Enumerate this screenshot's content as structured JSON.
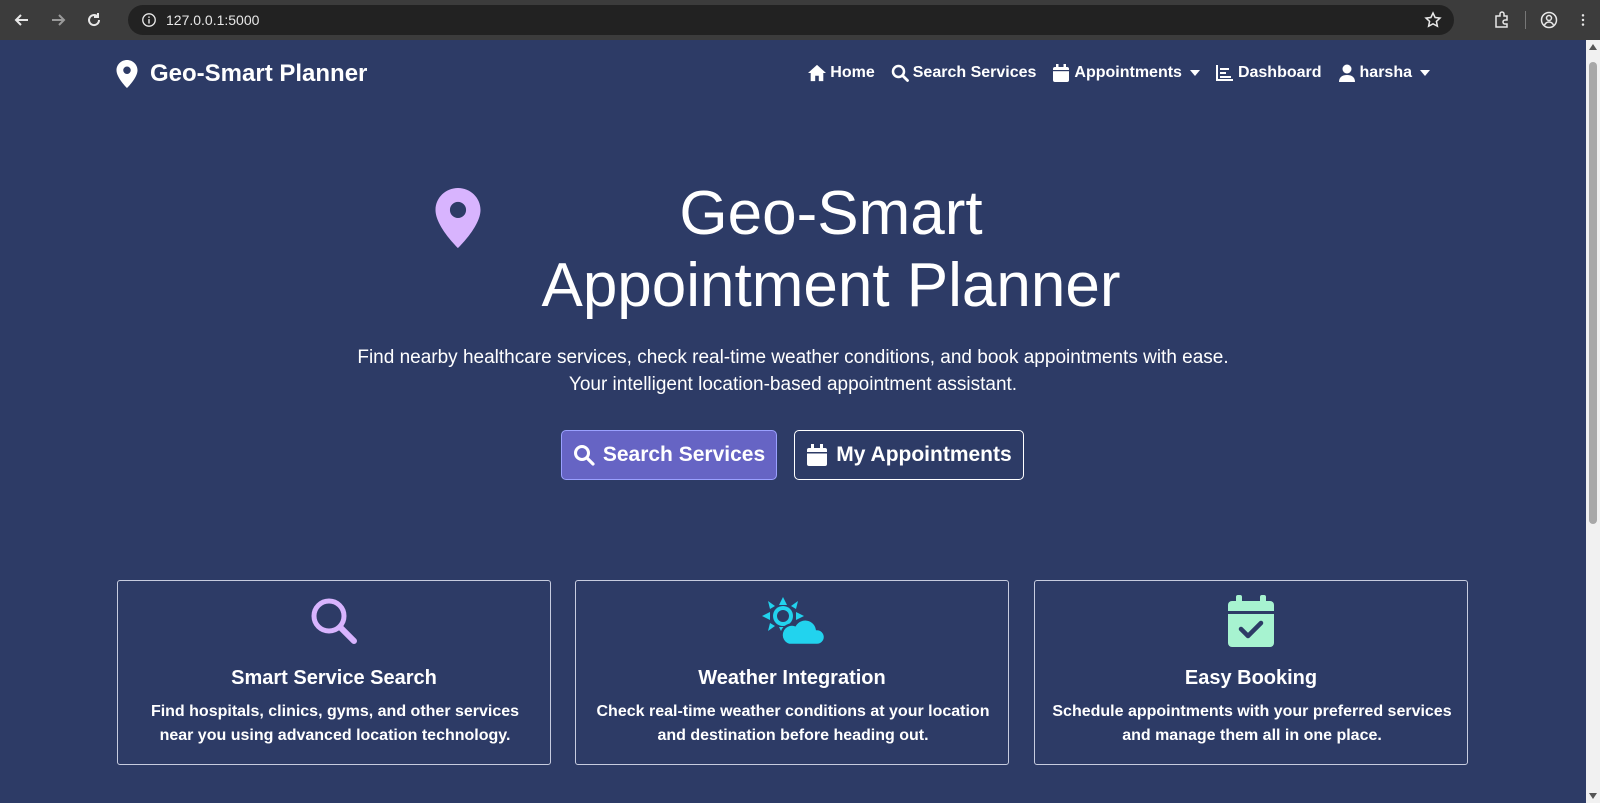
{
  "browser": {
    "url": "127.0.0.1:5000"
  },
  "navbar": {
    "brand": "Geo-Smart Planner",
    "links": [
      {
        "label": "Home",
        "icon": "home-icon"
      },
      {
        "label": "Search Services",
        "icon": "search-icon"
      },
      {
        "label": "Appointments",
        "icon": "calendar-icon",
        "dropdown": true
      },
      {
        "label": "Dashboard",
        "icon": "chart-icon"
      },
      {
        "label": "harsha",
        "icon": "user-icon",
        "dropdown": true
      }
    ]
  },
  "hero": {
    "title": "Geo-Smart Appointment Planner",
    "subtitle_line1": "Find nearby healthcare services, check real-time weather conditions, and book appointments with ease.",
    "subtitle_line2": "Your intelligent location-based appointment assistant.",
    "primary_button": "Search Services",
    "secondary_button": "My Appointments"
  },
  "features": [
    {
      "title": "Smart Service Search",
      "description": "Find hospitals, clinics, gyms, and other services near you using advanced location technology.",
      "icon": "search-icon",
      "icon_color": "#d8b4fe"
    },
    {
      "title": "Weather Integration",
      "description": "Check real-time weather conditions at your location and destination before heading out.",
      "icon": "weather-icon",
      "icon_color": "#22d3ee"
    },
    {
      "title": "Easy Booking",
      "description": "Schedule appointments with your preferred services and manage them all in one place.",
      "icon": "calendar-check-icon",
      "icon_color": "#a7f3d0"
    }
  ],
  "colors": {
    "background": "#2d3b66",
    "pin_accent": "#d8b4fe",
    "primary_button": "#6664c4"
  }
}
